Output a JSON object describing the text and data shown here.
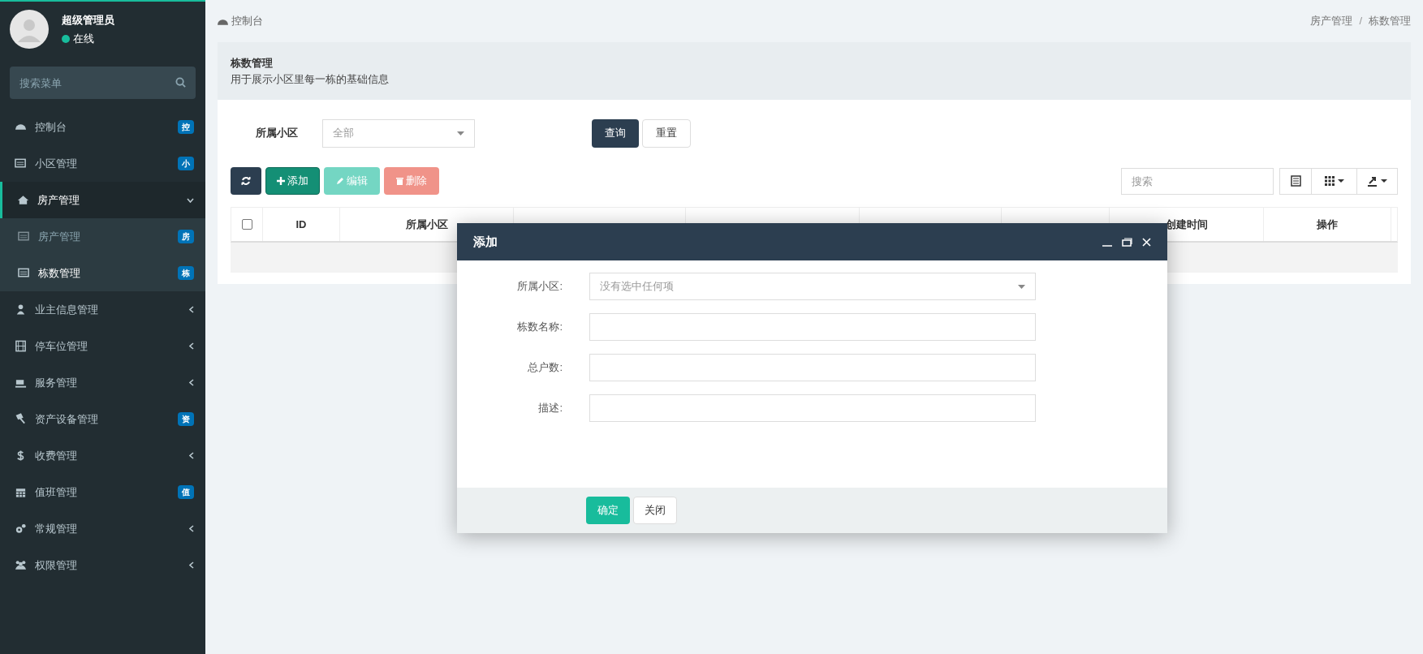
{
  "user": {
    "name": "超级管理员",
    "status": "在线",
    "online": true
  },
  "menu_search": {
    "placeholder": "搜索菜单"
  },
  "sidebar": {
    "items": [
      {
        "label": "控制台",
        "badge": "控",
        "selected": false
      },
      {
        "label": "小区管理",
        "badge": "小",
        "selected": false
      },
      {
        "label": "房产管理",
        "expanded": true,
        "selected": true,
        "children": [
          {
            "label": "房产管理",
            "badge": "房",
            "selected": false
          },
          {
            "label": "栋数管理",
            "badge": "栋",
            "selected": true
          }
        ]
      },
      {
        "label": "业主信息管理",
        "expanded": false,
        "selected": false
      },
      {
        "label": "停车位管理",
        "expanded": false,
        "selected": false
      },
      {
        "label": "服务管理",
        "expanded": false,
        "selected": false
      },
      {
        "label": "资产设备管理",
        "badge": "资",
        "selected": false
      },
      {
        "label": "收费管理",
        "expanded": false,
        "selected": false
      },
      {
        "label": "值班管理",
        "badge": "值",
        "selected": false
      },
      {
        "label": "常规管理",
        "expanded": false,
        "selected": false
      },
      {
        "label": "权限管理",
        "expanded": false,
        "selected": false
      }
    ]
  },
  "breadcrumb": {
    "home": "控制台",
    "separator": "/",
    "path": [
      "房产管理",
      "栋数管理"
    ]
  },
  "page_header": {
    "title": "栋数管理",
    "subtitle": "用于展示小区里每一栋的基础信息"
  },
  "filter": {
    "label": "所属小区",
    "value": "全部",
    "buttons": [
      "查询",
      "重置"
    ]
  },
  "toolbar": {
    "buttons": [
      {
        "kind": "refresh",
        "disabled": false
      },
      {
        "kind": "add",
        "label": "添加",
        "disabled": false
      },
      {
        "kind": "edit",
        "label": "编辑",
        "disabled": true
      },
      {
        "kind": "delete",
        "label": "删除",
        "disabled": true
      }
    ],
    "search": {
      "placeholder": "搜索"
    }
  },
  "table": {
    "select_all": {
      "checked": false
    },
    "columns_left": [
      "ID",
      "所属小区"
    ],
    "columns_right": [
      "创建时间",
      "操作"
    ]
  },
  "dialog": {
    "title": "添加",
    "fields": [
      {
        "label": "所属小区:",
        "kind": "select",
        "placeholder": "没有选中任何项"
      },
      {
        "label": "栋数名称:",
        "kind": "text"
      },
      {
        "label": "总户数:",
        "kind": "text"
      },
      {
        "label": "描述:",
        "kind": "text"
      }
    ],
    "buttons": [
      {
        "label": "确定",
        "primary": true
      },
      {
        "label": "关闭",
        "primary": false
      }
    ]
  }
}
